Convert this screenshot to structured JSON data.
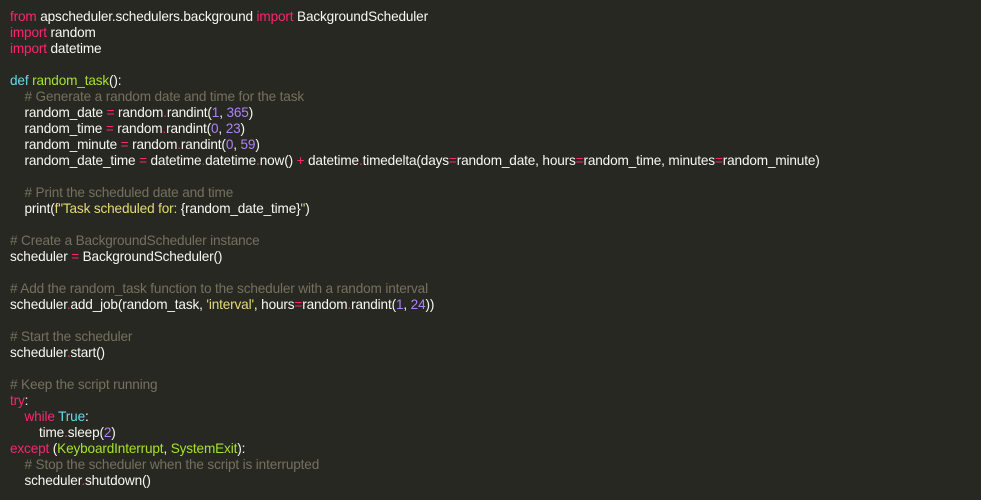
{
  "editor": {
    "background": "#272822",
    "colors": {
      "keyword": "#f92672",
      "storage": "#66d9ef",
      "function": "#a6e22e",
      "number": "#ae81ff",
      "string": "#e6db74",
      "comment": "#75715e",
      "text": "#f8f8f2"
    },
    "lines": [
      [
        {
          "t": "keyword",
          "v": "from"
        },
        {
          "t": "plain",
          "v": " apscheduler.schedulers.background "
        },
        {
          "t": "keyword",
          "v": "import"
        },
        {
          "t": "plain",
          "v": " BackgroundScheduler"
        }
      ],
      [
        {
          "t": "keyword",
          "v": "import"
        },
        {
          "t": "plain",
          "v": " random"
        }
      ],
      [
        {
          "t": "keyword",
          "v": "import"
        },
        {
          "t": "plain",
          "v": " datetime"
        }
      ],
      [],
      [
        {
          "t": "storage",
          "v": "def"
        },
        {
          "t": "plain",
          "v": " "
        },
        {
          "t": "func",
          "v": "random_task"
        },
        {
          "t": "plain",
          "v": "():"
        }
      ],
      [
        {
          "t": "plain",
          "v": "    "
        },
        {
          "t": "comment",
          "v": "# Generate a random date and time for the task"
        }
      ],
      [
        {
          "t": "plain",
          "v": "    random_date "
        },
        {
          "t": "op",
          "v": "="
        },
        {
          "t": "plain",
          "v": " random"
        },
        {
          "t": "op",
          "v": "."
        },
        {
          "t": "plain",
          "v": "randint("
        },
        {
          "t": "number",
          "v": "1"
        },
        {
          "t": "plain",
          "v": ", "
        },
        {
          "t": "number",
          "v": "365"
        },
        {
          "t": "plain",
          "v": ")"
        }
      ],
      [
        {
          "t": "plain",
          "v": "    random_time "
        },
        {
          "t": "op",
          "v": "="
        },
        {
          "t": "plain",
          "v": " random"
        },
        {
          "t": "op",
          "v": "."
        },
        {
          "t": "plain",
          "v": "randint("
        },
        {
          "t": "number",
          "v": "0"
        },
        {
          "t": "plain",
          "v": ", "
        },
        {
          "t": "number",
          "v": "23"
        },
        {
          "t": "plain",
          "v": ")"
        }
      ],
      [
        {
          "t": "plain",
          "v": "    random_minute "
        },
        {
          "t": "op",
          "v": "="
        },
        {
          "t": "plain",
          "v": " random"
        },
        {
          "t": "op",
          "v": "."
        },
        {
          "t": "plain",
          "v": "randint("
        },
        {
          "t": "number",
          "v": "0"
        },
        {
          "t": "plain",
          "v": ", "
        },
        {
          "t": "number",
          "v": "59"
        },
        {
          "t": "plain",
          "v": ")"
        }
      ],
      [
        {
          "t": "plain",
          "v": "    random_date_time "
        },
        {
          "t": "op",
          "v": "="
        },
        {
          "t": "plain",
          "v": " datetime"
        },
        {
          "t": "op",
          "v": "."
        },
        {
          "t": "plain",
          "v": "datetime"
        },
        {
          "t": "op",
          "v": "."
        },
        {
          "t": "plain",
          "v": "now() "
        },
        {
          "t": "op",
          "v": "+"
        },
        {
          "t": "plain",
          "v": " datetime"
        },
        {
          "t": "op",
          "v": "."
        },
        {
          "t": "plain",
          "v": "timedelta(days"
        },
        {
          "t": "op",
          "v": "="
        },
        {
          "t": "plain",
          "v": "random_date, hours"
        },
        {
          "t": "op",
          "v": "="
        },
        {
          "t": "plain",
          "v": "random_time, minutes"
        },
        {
          "t": "op",
          "v": "="
        },
        {
          "t": "plain",
          "v": "random_minute)"
        }
      ],
      [],
      [
        {
          "t": "plain",
          "v": "    "
        },
        {
          "t": "comment",
          "v": "# Print the scheduled date and time"
        }
      ],
      [
        {
          "t": "plain",
          "v": "    print("
        },
        {
          "t": "string",
          "v": "f\"Task scheduled for: "
        },
        {
          "t": "plain",
          "v": "{random_date_time}"
        },
        {
          "t": "string",
          "v": "\""
        },
        {
          "t": "plain",
          "v": ")"
        }
      ],
      [],
      [
        {
          "t": "comment",
          "v": "# Create a BackgroundScheduler instance"
        }
      ],
      [
        {
          "t": "plain",
          "v": "scheduler "
        },
        {
          "t": "op",
          "v": "="
        },
        {
          "t": "plain",
          "v": " BackgroundScheduler()"
        }
      ],
      [],
      [
        {
          "t": "comment",
          "v": "# Add the random_task function to the scheduler with a random interval"
        }
      ],
      [
        {
          "t": "plain",
          "v": "scheduler"
        },
        {
          "t": "op",
          "v": "."
        },
        {
          "t": "plain",
          "v": "add_job(random_task, "
        },
        {
          "t": "string",
          "v": "'interval'"
        },
        {
          "t": "plain",
          "v": ", hours"
        },
        {
          "t": "op",
          "v": "="
        },
        {
          "t": "plain",
          "v": "random"
        },
        {
          "t": "op",
          "v": "."
        },
        {
          "t": "plain",
          "v": "randint("
        },
        {
          "t": "number",
          "v": "1"
        },
        {
          "t": "plain",
          "v": ", "
        },
        {
          "t": "number",
          "v": "24"
        },
        {
          "t": "plain",
          "v": "))"
        }
      ],
      [],
      [
        {
          "t": "comment",
          "v": "# Start the scheduler"
        }
      ],
      [
        {
          "t": "plain",
          "v": "scheduler"
        },
        {
          "t": "op",
          "v": "."
        },
        {
          "t": "plain",
          "v": "start()"
        }
      ],
      [],
      [
        {
          "t": "comment",
          "v": "# Keep the script running"
        }
      ],
      [
        {
          "t": "keyword",
          "v": "try"
        },
        {
          "t": "plain",
          "v": ":"
        }
      ],
      [
        {
          "t": "plain",
          "v": "    "
        },
        {
          "t": "keyword",
          "v": "while"
        },
        {
          "t": "plain",
          "v": " "
        },
        {
          "t": "const",
          "v": "True"
        },
        {
          "t": "plain",
          "v": ":"
        }
      ],
      [
        {
          "t": "plain",
          "v": "        time"
        },
        {
          "t": "op",
          "v": "."
        },
        {
          "t": "plain",
          "v": "sleep("
        },
        {
          "t": "number",
          "v": "2"
        },
        {
          "t": "plain",
          "v": ")"
        }
      ],
      [
        {
          "t": "keyword",
          "v": "except"
        },
        {
          "t": "plain",
          "v": " ("
        },
        {
          "t": "exc",
          "v": "KeyboardInterrupt"
        },
        {
          "t": "plain",
          "v": ", "
        },
        {
          "t": "exc",
          "v": "SystemExit"
        },
        {
          "t": "plain",
          "v": "):"
        }
      ],
      [
        {
          "t": "plain",
          "v": "    "
        },
        {
          "t": "comment",
          "v": "# Stop the scheduler when the script is interrupted"
        }
      ],
      [
        {
          "t": "plain",
          "v": "    scheduler"
        },
        {
          "t": "op",
          "v": "."
        },
        {
          "t": "plain",
          "v": "shutdown()"
        }
      ]
    ]
  }
}
